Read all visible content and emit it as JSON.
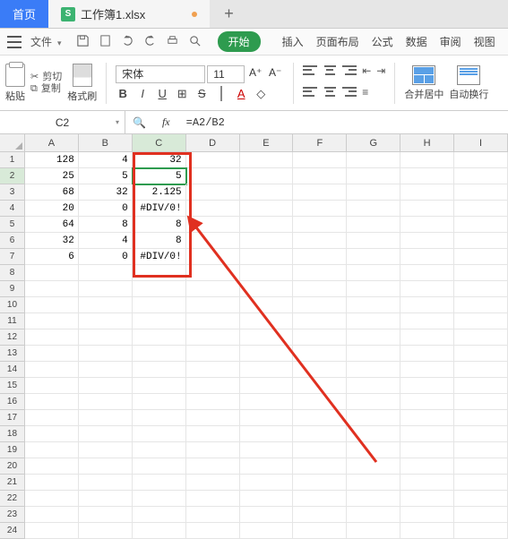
{
  "tabs": {
    "home": "首页",
    "filename": "工作簿1.xlsx",
    "doc_icon": "S"
  },
  "filerow": {
    "file": "文件"
  },
  "menu": {
    "start": "开始",
    "insert": "插入",
    "layout": "页面布局",
    "formula": "公式",
    "data": "数据",
    "review": "审阅",
    "view": "视图"
  },
  "ribbon": {
    "paste": "粘贴",
    "cut": "剪切",
    "copy": "复制",
    "brush": "格式刷",
    "font": "宋体",
    "size": "11",
    "aup": "A⁺",
    "adn": "A⁻",
    "merge": "合并居中",
    "wrap": "自动换行"
  },
  "namebox": "C2",
  "formula": "=A2/B2",
  "cols": [
    "A",
    "B",
    "C",
    "D",
    "E",
    "F",
    "G",
    "H",
    "I"
  ],
  "rowcount": 24,
  "griddata": {
    "A": [
      "",
      "128",
      "25",
      "68",
      "20",
      "64",
      "32",
      "6"
    ],
    "B": [
      "",
      "4",
      "5",
      "32",
      "0",
      "8",
      "4",
      "0"
    ],
    "C": [
      "",
      "32",
      "5",
      "2.125",
      "#DIV/0!",
      "8",
      "8",
      "#DIV/0!"
    ]
  },
  "active": {
    "row": 2,
    "col": "C"
  }
}
